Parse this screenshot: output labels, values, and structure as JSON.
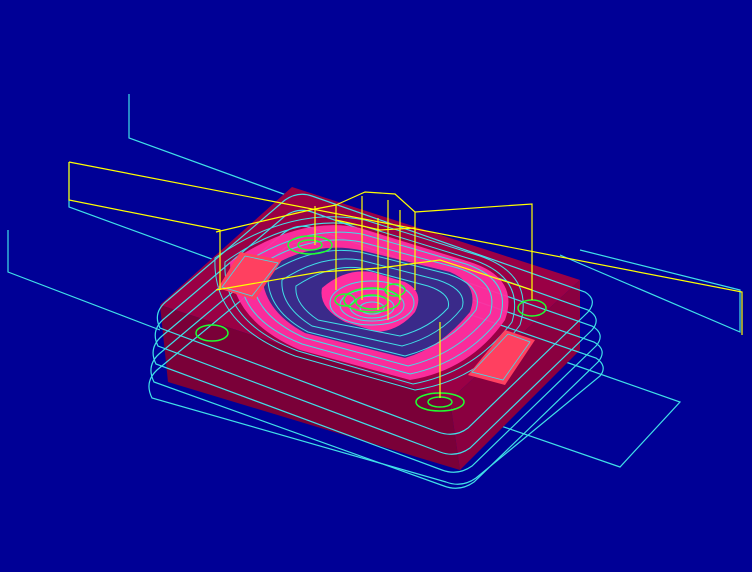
{
  "viewport": {
    "background": "#000096",
    "caption": ""
  },
  "colors": {
    "rapid_move": "#FFFF00",
    "feed_path": "#40E0E8",
    "stock_solid": "#B0004A",
    "stock_side": "#8A0040",
    "machined_face": "#FF2EA0",
    "finish_pass": "#20FF30",
    "slot_pocket": "#FF4060"
  },
  "toolpath_layers": [
    {
      "name": "stock-body",
      "color_key": "stock_solid"
    },
    {
      "name": "roughing-contour-stack",
      "color_key": "feed_path"
    },
    {
      "name": "pocket-spiral",
      "color_key": "feed_path"
    },
    {
      "name": "rapid-retracts",
      "color_key": "rapid_move"
    },
    {
      "name": "corner-finishing",
      "color_key": "finish_pass"
    },
    {
      "name": "machined-surface",
      "color_key": "machined_face"
    }
  ]
}
